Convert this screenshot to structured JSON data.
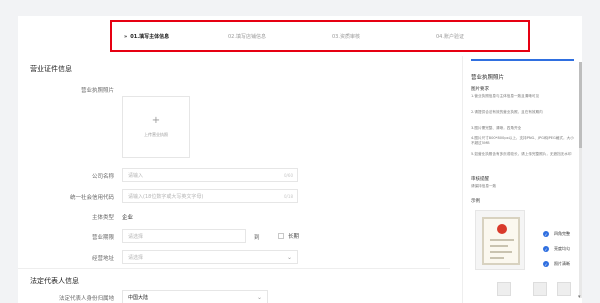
{
  "stepper": {
    "steps": [
      {
        "label": "01.填写主体信息",
        "active": true
      },
      {
        "label": "02.填写店铺信息",
        "active": false
      },
      {
        "label": "03.资质审核",
        "active": false
      },
      {
        "label": "04.账户验证",
        "active": false
      }
    ],
    "active_marker": "»",
    "highlight_color": "#e60012"
  },
  "license_section": {
    "title": "营业证件信息",
    "license_photo_label": "营业执照照片",
    "upload_plus": "+",
    "upload_text": "上传营业执照",
    "company_name": {
      "label": "公司名称",
      "placeholder": "请输入",
      "count": "0/60"
    },
    "credit_code": {
      "label": "统一社会信用代码",
      "placeholder": "请输入(18位数字或大写英文字母)",
      "count": "0/18"
    },
    "subject_type": {
      "label": "主体类型",
      "value": "企业"
    },
    "business_term": {
      "label": "营业期限",
      "placeholder": "请选择",
      "to": "到",
      "long_term": "长期"
    },
    "business_address": {
      "label": "经营地址",
      "placeholder": "请选择"
    }
  },
  "legal_section": {
    "title": "法定代表人信息",
    "id_country": {
      "label": "法定代表人身份归属地",
      "value": "中国大陆"
    }
  },
  "side_panel": {
    "title": "营业执照照片",
    "req_title": "图片要求",
    "requirements": [
      "1.营业执照信息与主体信息一致且清晰可见",
      "2.请提供合法有效的营业执照，且在有效期内",
      "3.图片需完整、清晰，四角齐全",
      "4.图片尺寸800*800px以上，支持PNG、JPG和JPEG格式，大小不超过5MB",
      "5.如营业执照含有多页或较长，请上传完整照片，无遮挡无水印"
    ],
    "audit_title": "审核提醒",
    "audit_text": "请保持信息一致",
    "example_title": "示例",
    "checks": [
      "四角完整",
      "亮度均匀",
      "照片清晰"
    ],
    "accent": "#2f6fe0"
  }
}
